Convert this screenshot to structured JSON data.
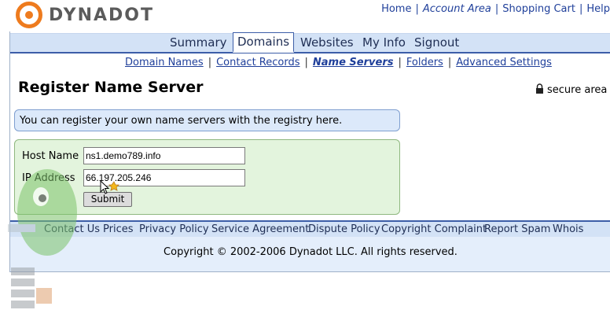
{
  "logo": {
    "text": "DYNADOT"
  },
  "top_links": [
    {
      "label": "Home",
      "italic": false
    },
    {
      "label": "Account Area",
      "italic": true
    },
    {
      "label": "Shopping Cart",
      "italic": false
    },
    {
      "label": "Help",
      "italic": false
    }
  ],
  "tabs": [
    {
      "label": "Summary",
      "active": false
    },
    {
      "label": "Domains",
      "active": true
    },
    {
      "label": "Websites",
      "active": false
    },
    {
      "label": "My Info",
      "active": false
    },
    {
      "label": "Signout",
      "active": false
    }
  ],
  "subnav": [
    {
      "label": "Domain Names",
      "current": false
    },
    {
      "label": "Contact Records",
      "current": false
    },
    {
      "label": "Name Servers",
      "current": true
    },
    {
      "label": "Folders",
      "current": false
    },
    {
      "label": "Advanced Settings",
      "current": false
    }
  ],
  "page": {
    "title": "Register Name Server",
    "secure_label": "secure area",
    "info_text": "You can register your own name servers with the registry here."
  },
  "form": {
    "host_label": "Host Name",
    "host_value": "ns1.demo789.info",
    "ip_label": "IP Address",
    "ip_value": "66.197.205.246",
    "submit_label": "Submit"
  },
  "footer": {
    "links": [
      "Contact Us",
      "Prices",
      "Privacy Policy",
      "Service Agreement",
      "Dispute Policy",
      "Copyright Complaint",
      "Report Spam",
      "Whois"
    ],
    "copyright": "Copyright © 2002-2006 Dynadot LLC. All rights reserved."
  },
  "colors": {
    "brand_orange": "#ee7b1e",
    "nav_bg": "#d3e2f6",
    "nav_border": "#3d5ea8",
    "info_bg": "#dce9fa",
    "form_bg": "#e3f4dd"
  },
  "icons": [
    "lock-icon",
    "mouse-cursor-icon",
    "logo-icon"
  ]
}
